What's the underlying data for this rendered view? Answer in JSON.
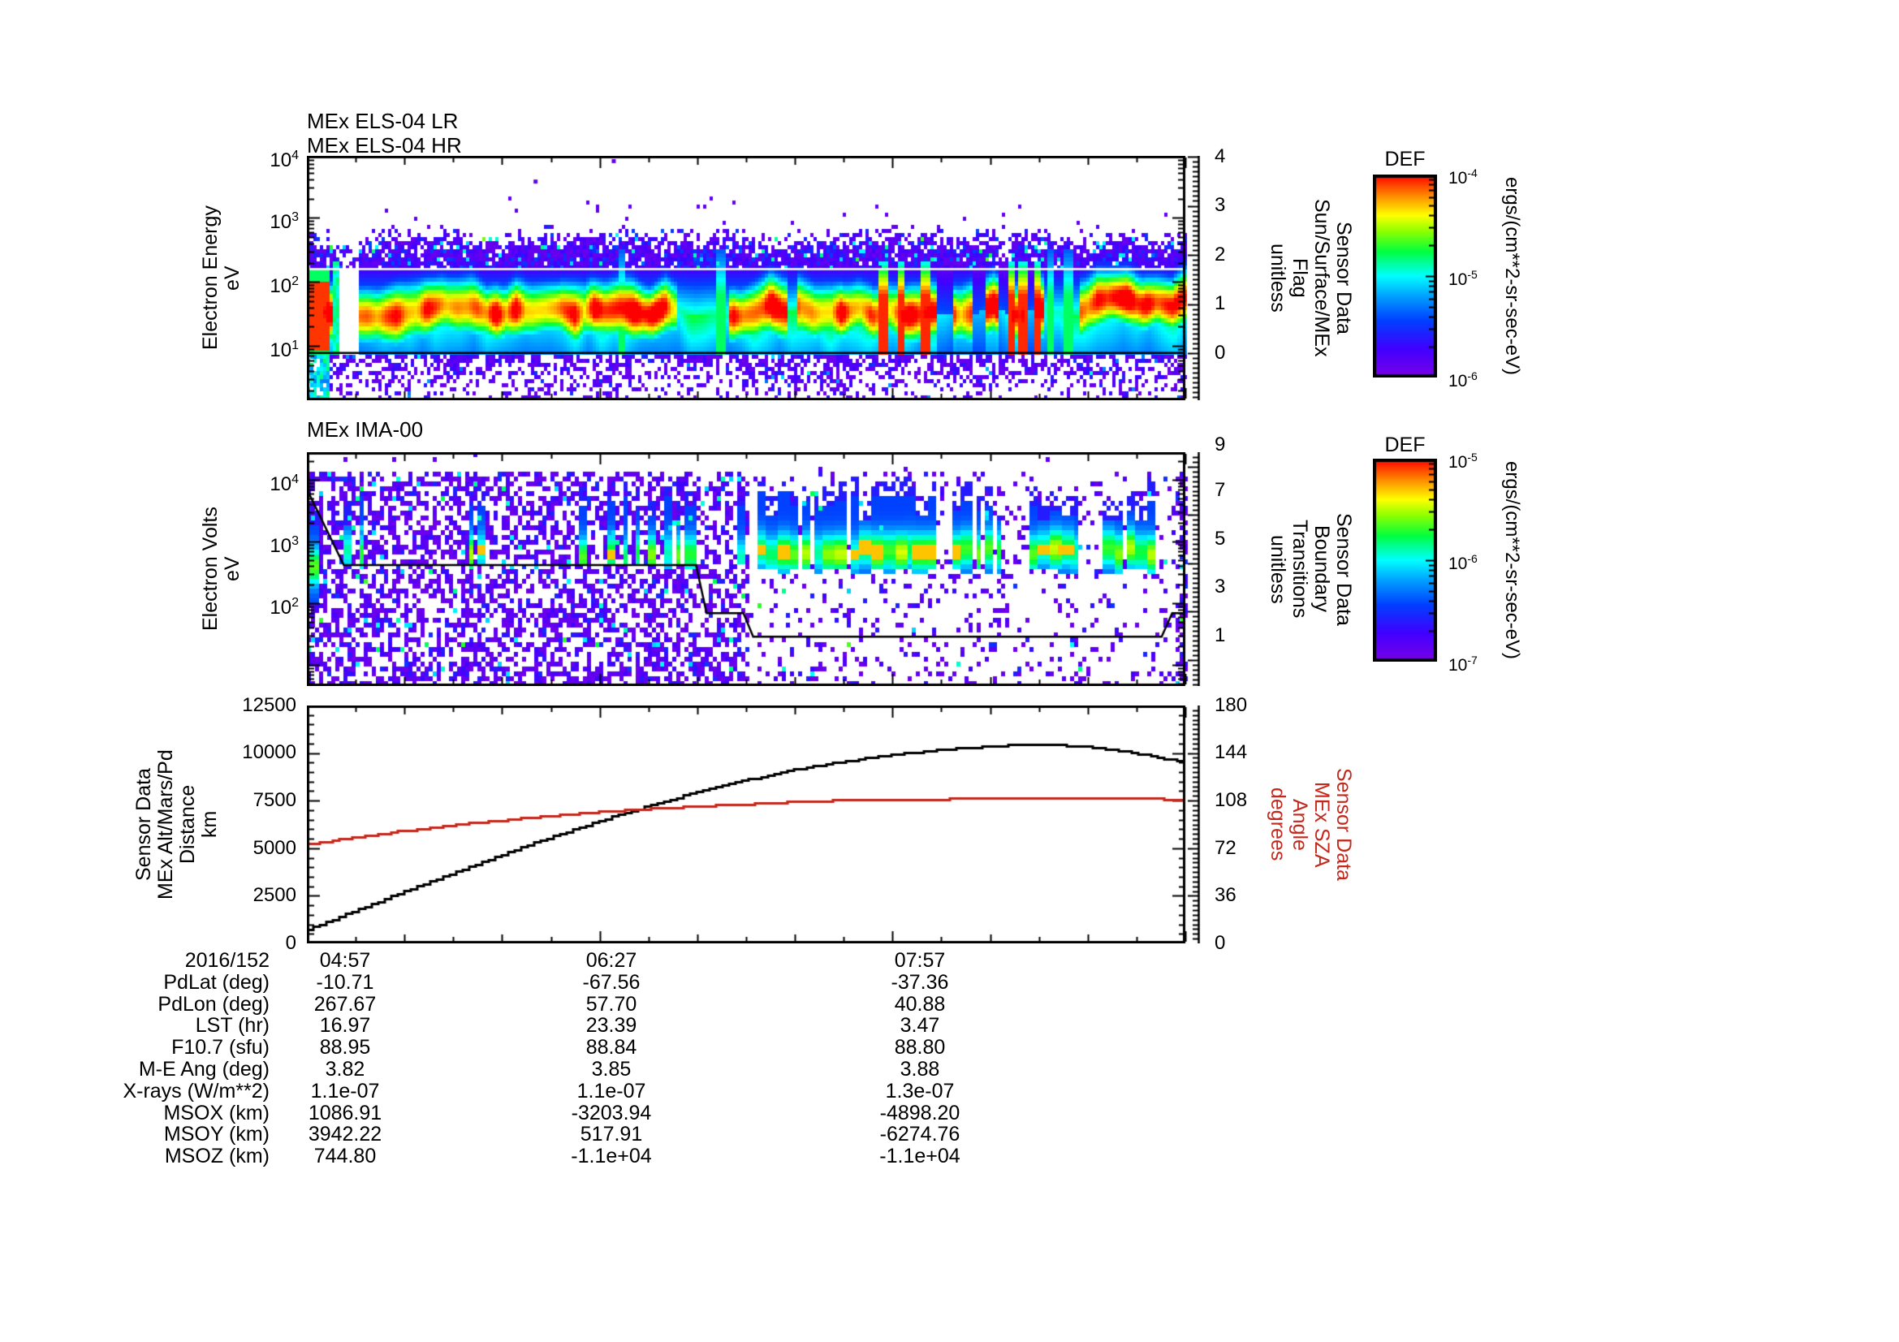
{
  "titles": {
    "panel1_line1": "MEx ELS-04 LR",
    "panel1_line2": "MEx ELS-04 HR",
    "panel2": "MEx IMA-00"
  },
  "axis_labels": {
    "panel1_left": "Electron Energy\neV",
    "panel1_right": "Sensor Data\nSun/Surface/MEx\nFlag\nunitless",
    "panel2_left": "Electron Volts\neV",
    "panel2_right": "Sensor Data\nBoundary\nTransitions\nunitless",
    "panel3_left": "Sensor Data\nMEx Alt/Mars/Pd\nDistance\nkm",
    "panel3_right": "Sensor Data\nMEx SZA\nAngle\ndegrees"
  },
  "ticks": {
    "panel1_left": [
      {
        "base": "10",
        "exp": "4"
      },
      {
        "base": "10",
        "exp": "3"
      },
      {
        "base": "10",
        "exp": "2"
      },
      {
        "base": "10",
        "exp": "1"
      }
    ],
    "panel1_right": [
      "4",
      "3",
      "2",
      "1",
      "0"
    ],
    "panel2_left": [
      {
        "base": "10",
        "exp": "4"
      },
      {
        "base": "10",
        "exp": "3"
      },
      {
        "base": "10",
        "exp": "2"
      }
    ],
    "panel2_right": [
      "9",
      "7",
      "5",
      "3",
      "1"
    ],
    "panel3_left": [
      "12500",
      "10000",
      "7500",
      "5000",
      "2500",
      "0"
    ],
    "panel3_right": [
      "180",
      "144",
      "108",
      "72",
      "36",
      "0"
    ],
    "time": [
      "04:57",
      "06:27",
      "07:57"
    ],
    "date": "2016/152"
  },
  "colorbars": [
    {
      "title": "DEF",
      "unit": "ergs/(cm**2-sr-sec-eV)",
      "tick_labels": [
        {
          "base": "10",
          "exp": "-4"
        },
        {
          "base": "10",
          "exp": "-5"
        },
        {
          "base": "10",
          "exp": "-6"
        }
      ]
    },
    {
      "title": "DEF",
      "unit": "ergs/(cm**2-sr-sec-eV)",
      "tick_labels": [
        {
          "base": "10",
          "exp": "-5"
        },
        {
          "base": "10",
          "exp": "-6"
        },
        {
          "base": "10",
          "exp": "-7"
        }
      ]
    }
  ],
  "table": {
    "rows": [
      {
        "label": "2016/152",
        "values": [
          "04:57",
          "06:27",
          "07:57"
        ]
      },
      {
        "label": "PdLat (deg)",
        "values": [
          "-10.71",
          "-67.56",
          "-37.36"
        ]
      },
      {
        "label": "PdLon (deg)",
        "values": [
          "267.67",
          "57.70",
          "40.88"
        ]
      },
      {
        "label": "LST (hr)",
        "values": [
          "16.97",
          "23.39",
          "3.47"
        ]
      },
      {
        "label": "F10.7 (sfu)",
        "values": [
          "88.95",
          "88.84",
          "88.80"
        ]
      },
      {
        "label": "M-E Ang (deg)",
        "values": [
          "3.82",
          "3.85",
          "3.88"
        ]
      },
      {
        "label": "X-rays (W/m**2)",
        "values": [
          "1.1e-07",
          "1.1e-07",
          "1.3e-07"
        ]
      },
      {
        "label": "MSOX (km)",
        "values": [
          "1086.91",
          "-3203.94",
          "-4898.20"
        ]
      },
      {
        "label": "MSOY (km)",
        "values": [
          "3942.22",
          "517.91",
          "-6274.76"
        ]
      },
      {
        "label": "MSOZ (km)",
        "values": [
          "744.80",
          "-1.1e+04",
          "-1.1e+04"
        ]
      }
    ]
  },
  "colors": {
    "black": "#000000",
    "background": "#ffffff",
    "accent_red": "#c3281c"
  },
  "chart_data": [
    {
      "type": "heatmap",
      "panel": "ELS",
      "title": "MEx ELS-04 LR / MEx ELS-04 HR",
      "x_axis": {
        "start": "04:57",
        "end": "09:27",
        "labels": [
          "04:57",
          "06:27",
          "07:57"
        ],
        "label_fracs": [
          0,
          0.3333,
          0.6667
        ],
        "minutes": 270
      },
      "y_axis": {
        "label": "Electron Energy eV",
        "scale": "log",
        "log_top": 3.97,
        "log_bottom": 0.15
      },
      "right_axis": {
        "label": "Sensor Data Sun/Surface/MEx Flag unitless",
        "ticks": [
          0,
          1,
          2,
          3,
          4
        ]
      },
      "z_axis": {
        "label": "DEF ergs/(cm**2-sr-sec-eV)",
        "range": [
          "1e-6",
          "1e-4"
        ]
      },
      "band": {
        "center_log_eV": 1.56,
        "red_core_eV": [
          20,
          90
        ],
        "shelf_bottom_log": 0.89,
        "speckle_top_log": 2.85
      },
      "overlays": {
        "white_line_log_eV": 2.2,
        "black_line_log_eV": 0.89
      },
      "features": {
        "left_blob_frac": [
          0,
          0.024
        ],
        "gaps": [
          [
            0.027,
            0.058,
            0.02
          ],
          [
            0.42,
            0.478,
            0.5
          ],
          [
            0.545,
            0.557,
            0.45
          ],
          [
            0.716,
            0.734,
            0.22
          ],
          [
            0.755,
            0.77,
            0.28
          ],
          [
            0.787,
            0.8,
            0.18
          ],
          [
            0.817,
            0.825,
            0.25
          ],
          [
            0.836,
            0.877,
            0.35
          ]
        ],
        "red_spikes": [
          0.655,
          0.675,
          0.702,
          0.8,
          0.814,
          0.83
        ],
        "green_spikes": [
          0.357,
          0.47,
          0.845,
          0.865
        ],
        "outlier_dots_frac_logE": [
          [
            0.258,
            3.6
          ],
          [
            0.347,
            3.92
          ]
        ]
      }
    },
    {
      "type": "heatmap",
      "panel": "IMA",
      "title": "MEx IMA-00",
      "x_axis": {
        "start": "04:57",
        "end": "09:27",
        "labels": [
          "04:57",
          "06:27",
          "07:57"
        ],
        "label_fracs": [
          0,
          0.3333,
          0.6667
        ],
        "minutes": 270
      },
      "y_axis": {
        "label": "Electron Volts eV",
        "scale": "log",
        "log_top": 4.45,
        "log_bottom": 0.66
      },
      "right_axis": {
        "label": "Sensor Data Boundary Transitions unitless",
        "ticks": [
          1,
          3,
          5,
          7,
          9
        ]
      },
      "z_axis": {
        "label": "DEF ergs/(cm**2-sr-sec-eV)",
        "range": [
          "1e-7",
          "1e-5"
        ]
      },
      "regions": {
        "dense_speckle_frac": [
          0,
          0.503
        ],
        "gap_frac": [
          0.503,
          0.512
        ],
        "sparse_frac": [
          0.512,
          0.985
        ],
        "dense_right_frac": [
          0.985,
          1
        ],
        "data_top_log": 4.17
      },
      "streaks": {
        "band_log_eV": [
          2.45,
          3.65
        ],
        "core_log_eV": 2.85
      },
      "boundary_line_frac_logE": [
        [
          0,
          3.85
        ],
        [
          0.042,
          2.62
        ],
        [
          0.443,
          2.62
        ],
        [
          0.455,
          1.84
        ],
        [
          0.497,
          1.84
        ],
        [
          0.508,
          1.46
        ],
        [
          0.973,
          1.46
        ],
        [
          0.985,
          1.84
        ],
        [
          1,
          1.84
        ]
      ]
    },
    {
      "type": "line",
      "x_axis": {
        "start": "04:57",
        "end": "09:27",
        "labels": [
          "04:57",
          "06:27",
          "07:57"
        ],
        "label_fracs": [
          0,
          0.3333,
          0.6667
        ],
        "minutes": 270
      },
      "left_axis": {
        "label": "Sensor Data MEx Alt/Mars/Pd Distance km",
        "range": [
          0,
          12500
        ]
      },
      "right_axis": {
        "label": "Sensor Data MEx SZA Angle degrees",
        "range": [
          0,
          180
        ]
      },
      "series": [
        {
          "name": "MEx Alt/Mars/Pd Distance",
          "axis": "left",
          "color": "#000000",
          "x_frac": [
            0,
            0.05,
            0.1,
            0.15,
            0.2,
            0.25,
            0.3,
            0.35,
            0.4,
            0.45,
            0.5,
            0.55,
            0.6,
            0.65,
            0.7,
            0.75,
            0.8,
            0.83,
            0.87,
            0.9,
            0.95,
            1
          ],
          "values": [
            725,
            1650,
            2550,
            3450,
            4300,
            5150,
            5950,
            6700,
            7400,
            8050,
            8600,
            9100,
            9500,
            9830,
            10090,
            10290,
            10420,
            10440,
            10400,
            10280,
            9950,
            9520
          ]
        },
        {
          "name": "MEx SZA Angle",
          "axis": "right",
          "color": "#c3281c",
          "x_frac": [
            0,
            0.05,
            0.1,
            0.15,
            0.2,
            0.25,
            0.3,
            0.35,
            0.4,
            0.45,
            0.5,
            0.55,
            0.6,
            0.65,
            0.7,
            0.8,
            0.9,
            0.97,
            1
          ],
          "values": [
            75,
            80,
            84.5,
            88.5,
            92,
            95,
            98,
            100.5,
            102.5,
            104,
            105.5,
            107,
            108.3,
            109,
            109.3,
            109.5,
            109.5,
            109.5,
            108.3
          ]
        }
      ]
    }
  ]
}
